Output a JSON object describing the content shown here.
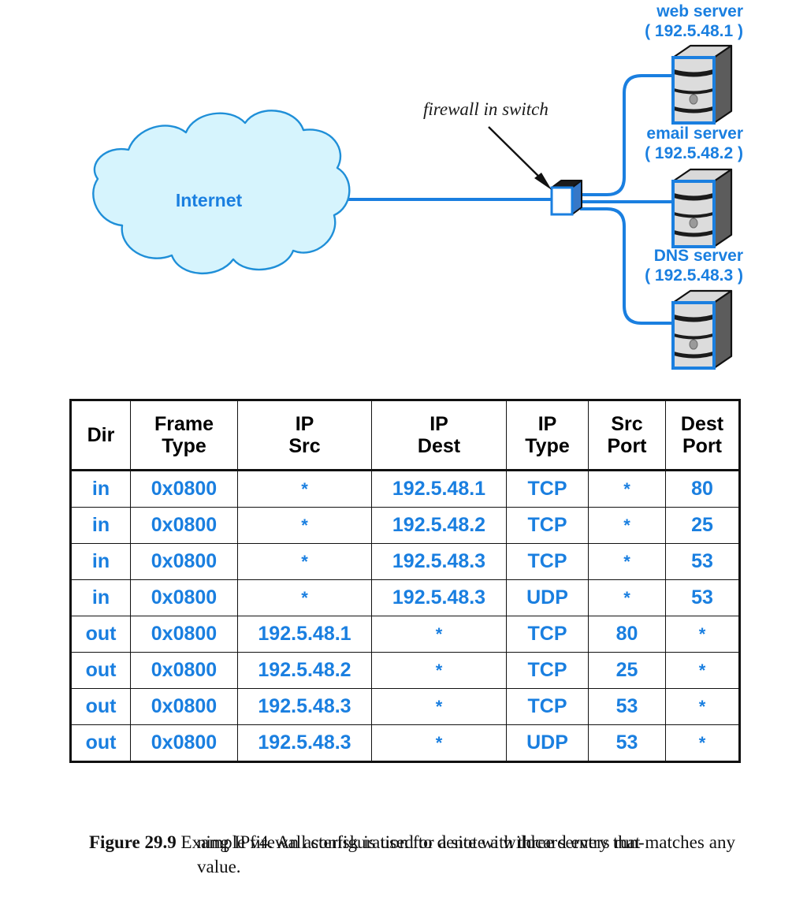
{
  "diagram": {
    "cloud_label": "Internet",
    "firewall_annotation": "firewall in switch",
    "servers": [
      {
        "name": "web server",
        "address": "( 192.5.48.1 )"
      },
      {
        "name": "email server",
        "address": "( 192.5.48.2 )"
      },
      {
        "name": "DNS server",
        "address": "( 192.5.48.3 )"
      }
    ],
    "icons": {
      "cloud": "cloud-icon",
      "switch": "firewall-switch-cube-icon",
      "pointer": "arrow-pointer-icon",
      "server": "server-tower-icon"
    },
    "colors": {
      "accent_blue": "#1a7fe0",
      "cloud_fill": "#d6f4fd",
      "cloud_stroke": "#1f8fd8",
      "link_line": "#1a7fe0",
      "server_front": "#d6d6d6",
      "server_side": "#5a5a5a",
      "ink": "#111111"
    }
  },
  "table": {
    "headers": [
      {
        "l1": "Dir",
        "l2": ""
      },
      {
        "l1": "Frame",
        "l2": "Type"
      },
      {
        "l1": "IP",
        "l2": "Src"
      },
      {
        "l1": "IP",
        "l2": "Dest"
      },
      {
        "l1": "IP",
        "l2": "Type"
      },
      {
        "l1": "Src",
        "l2": "Port"
      },
      {
        "l1": "Dest",
        "l2": "Port"
      }
    ],
    "rows": [
      {
        "dir": "in",
        "frame_type": "0x0800",
        "ip_src": "*",
        "ip_dest": "192.5.48.1",
        "ip_type": "TCP",
        "src_port": "*",
        "dest_port": "80"
      },
      {
        "dir": "in",
        "frame_type": "0x0800",
        "ip_src": "*",
        "ip_dest": "192.5.48.2",
        "ip_type": "TCP",
        "src_port": "*",
        "dest_port": "25"
      },
      {
        "dir": "in",
        "frame_type": "0x0800",
        "ip_src": "*",
        "ip_dest": "192.5.48.3",
        "ip_type": "TCP",
        "src_port": "*",
        "dest_port": "53"
      },
      {
        "dir": "in",
        "frame_type": "0x0800",
        "ip_src": "*",
        "ip_dest": "192.5.48.3",
        "ip_type": "UDP",
        "src_port": "*",
        "dest_port": "53"
      },
      {
        "dir": "out",
        "frame_type": "0x0800",
        "ip_src": "192.5.48.1",
        "ip_dest": "*",
        "ip_type": "TCP",
        "src_port": "80",
        "dest_port": "*"
      },
      {
        "dir": "out",
        "frame_type": "0x0800",
        "ip_src": "192.5.48.2",
        "ip_dest": "*",
        "ip_type": "TCP",
        "src_port": "25",
        "dest_port": "*"
      },
      {
        "dir": "out",
        "frame_type": "0x0800",
        "ip_src": "192.5.48.3",
        "ip_dest": "*",
        "ip_type": "TCP",
        "src_port": "53",
        "dest_port": "*"
      },
      {
        "dir": "out",
        "frame_type": "0x0800",
        "ip_src": "192.5.48.3",
        "ip_dest": "*",
        "ip_type": "UDP",
        "src_port": "53",
        "dest_port": "*"
      }
    ]
  },
  "caption": {
    "label": "Figure 29.9",
    "line1": "Example firewall configuration for a site with three servers run-",
    "line2": "ning IPv4.  An asterisk is used to denote a wildcard entry that",
    "line3": "matches any value."
  }
}
